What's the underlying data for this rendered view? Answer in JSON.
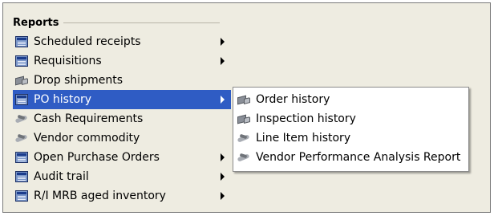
{
  "menu": {
    "title": "Reports",
    "items": [
      {
        "label": "Scheduled receipts",
        "icon": "report-icon",
        "has_submenu": true
      },
      {
        "label": "Requisitions",
        "icon": "report-icon",
        "has_submenu": true
      },
      {
        "label": "Drop shipments",
        "icon": "truck-icon",
        "has_submenu": false
      },
      {
        "label": "PO history",
        "icon": "report-icon",
        "has_submenu": true,
        "selected": true
      },
      {
        "label": "Cash Requirements",
        "icon": "handshake-icon",
        "has_submenu": false
      },
      {
        "label": "Vendor commodity",
        "icon": "handshake-icon",
        "has_submenu": false
      },
      {
        "label": "Open Purchase Orders",
        "icon": "report-icon",
        "has_submenu": true
      },
      {
        "label": "Audit trail",
        "icon": "report-icon",
        "has_submenu": true
      },
      {
        "label": "R/I MRB aged inventory",
        "icon": "report-icon",
        "has_submenu": true
      }
    ]
  },
  "submenu": {
    "items": [
      {
        "label": "Order history",
        "icon": "truck-icon"
      },
      {
        "label": "Inspection history",
        "icon": "truck-icon"
      },
      {
        "label": "Line Item history",
        "icon": "handshake-icon"
      },
      {
        "label": "Vendor Performance Analysis Report",
        "icon": "handshake-icon"
      }
    ]
  },
  "colors": {
    "background": "#eeece1",
    "selection": "#2f5cc4",
    "submenu_background": "#ffffff"
  }
}
